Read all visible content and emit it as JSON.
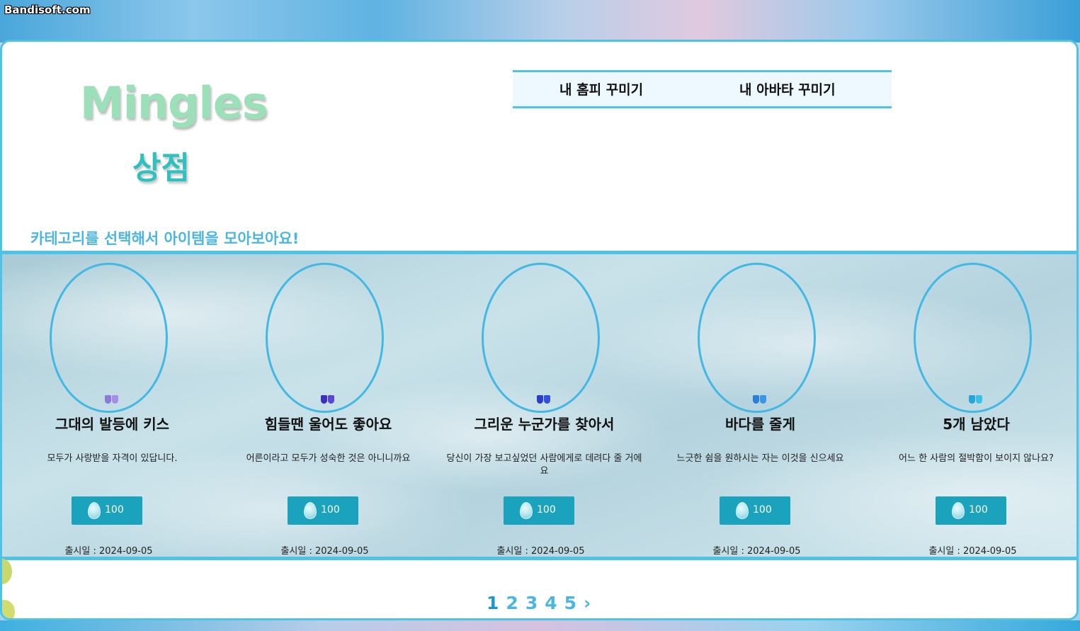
{
  "watermark": "Bandisoft.com",
  "logo": "Mingles",
  "page_title": "상점",
  "nav": {
    "items": [
      "내 홈피 꾸미기",
      "내 아바타 꾸미기"
    ]
  },
  "category_hint": "카테고리를 선택해서 아이템을 모아보아요!",
  "items": [
    {
      "name": "그대의 발등에 키스",
      "desc": "모두가 사랑받을 자격이 있답니다.",
      "price": "100",
      "release": "출시일 : 2024-09-05",
      "color_left": "#8a7bd8",
      "color_right": "#a78de6"
    },
    {
      "name": "힘들땐 울어도 좋아요",
      "desc": "어른이라고 모두가 성숙한 것은 아니니까요",
      "price": "100",
      "release": "출시일 : 2024-09-05",
      "color_left": "#3d2fc2",
      "color_right": "#5a45d6"
    },
    {
      "name": "그리운 누군가를 찾아서",
      "desc": "당신이 가장 보고싶었던 사람에게로 데려다 줄 거에요",
      "price": "100",
      "release": "출시일 : 2024-09-05",
      "color_left": "#2a3fc9",
      "color_right": "#3450d8"
    },
    {
      "name": "바다를 줄게",
      "desc": "느긋한 쉼을 원하시는 자는 이것을 신으세요",
      "price": "100",
      "release": "출시일 : 2024-09-05",
      "color_left": "#2a7fd8",
      "color_right": "#3b95e6"
    },
    {
      "name": "5개 남았다",
      "desc": "어느 한 사람의 절박함이 보이지 않나요?",
      "price": "100",
      "release": "출시일 : 2024-09-05",
      "color_left": "#25a6d6",
      "color_right": "#3bc1e6"
    }
  ],
  "pagination": {
    "pages": [
      "1",
      "2",
      "3",
      "4",
      "5"
    ],
    "current": "1",
    "next": "›"
  },
  "colors": {
    "accent": "#4fc2e6",
    "button": "#1ba3bd",
    "logo": "#9be0b9",
    "title": "#2fc0c0"
  }
}
